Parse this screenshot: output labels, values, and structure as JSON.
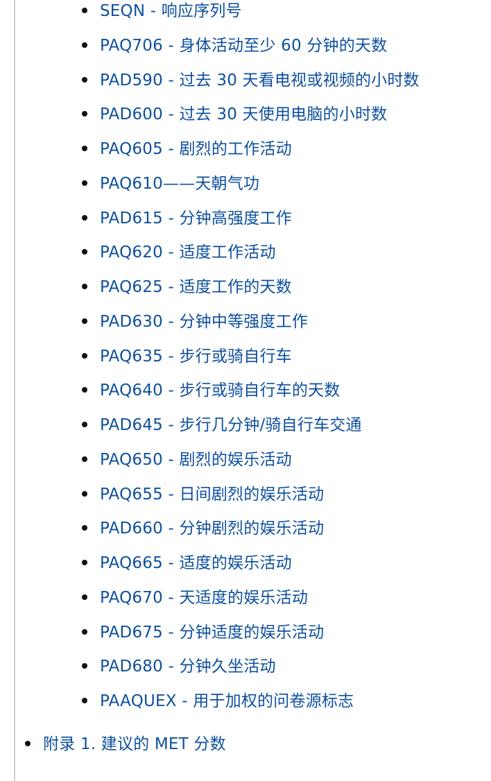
{
  "toc": {
    "sub_items": [
      {
        "code": "SEQN",
        "label": "响应序列号"
      },
      {
        "code": "PAQ706",
        "label": "身体活动至少 60 分钟的天数"
      },
      {
        "code": "PAD590",
        "label": "过去 30 天看电视或视频的小时数"
      },
      {
        "code": "PAD600",
        "label": "过去 30 天使用电脑的小时数"
      },
      {
        "code": "PAQ605",
        "label": "剧烈的工作活动"
      },
      {
        "code": "PAQ610",
        "label": "天朝气功"
      },
      {
        "code": "PAD615",
        "label": "分钟高强度工作"
      },
      {
        "code": "PAQ620",
        "label": "适度工作活动"
      },
      {
        "code": "PAQ625",
        "label": "适度工作的天数"
      },
      {
        "code": "PAD630",
        "label": "分钟中等强度工作"
      },
      {
        "code": "PAQ635",
        "label": "步行或骑自行车"
      },
      {
        "code": "PAQ640",
        "label": "步行或骑自行车的天数"
      },
      {
        "code": "PAD645",
        "label": "步行几分钟/骑自行车交通"
      },
      {
        "code": "PAQ650",
        "label": "剧烈的娱乐活动"
      },
      {
        "code": "PAQ655",
        "label": "日间剧烈的娱乐活动"
      },
      {
        "code": "PAD660",
        "label": "分钟剧烈的娱乐活动"
      },
      {
        "code": "PAQ665",
        "label": "适度的娱乐活动"
      },
      {
        "code": "PAQ670",
        "label": "天适度的娱乐活动"
      },
      {
        "code": "PAD675",
        "label": "分钟适度的娱乐活动"
      },
      {
        "code": "PAD680",
        "label": "分钟久坐活动"
      },
      {
        "code": "PAAQUEX",
        "label": "用于加权的问卷源标志"
      }
    ],
    "sub_item_texts": [
      "SEQN - 响应序列号",
      "PAQ706 - 身体活动至少 60 分钟的天数",
      "PAD590 - 过去 30 天看电视或视频的小时数",
      "PAD600 - 过去 30 天使用电脑的小时数",
      "PAQ605 - 剧烈的工作活动",
      "PAQ610——天朝气功",
      "PAD615 - 分钟高强度工作",
      "PAQ620 - 适度工作活动",
      "PAQ625 - 适度工作的天数",
      "PAD630 - 分钟中等强度工作",
      "PAQ635 - 步行或骑自行车",
      "PAQ640 - 步行或骑自行车的天数",
      "PAD645 - 步行几分钟/骑自行车交通",
      "PAQ650 - 剧烈的娱乐活动",
      "PAQ655 - 日间剧烈的娱乐活动",
      "PAD660 - 分钟剧烈的娱乐活动",
      "PAQ665 - 适度的娱乐活动",
      "PAQ670 - 天适度的娱乐活动",
      "PAD675 - 分钟适度的娱乐活动",
      "PAD680 - 分钟久坐活动",
      "PAAQUEX - 用于加权的问卷源标志"
    ],
    "top_item_text": "附录 1. 建议的 MET 分数"
  },
  "colors": {
    "link": "#0d4f9e",
    "bullet": "#111111",
    "panel_border": "#cfcfcf",
    "background": "#ffffff"
  }
}
